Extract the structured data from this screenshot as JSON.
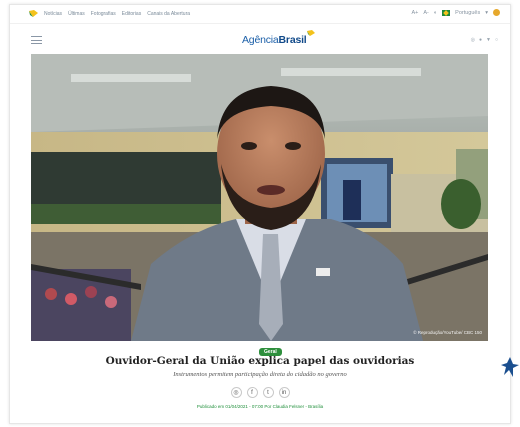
{
  "topbar": {
    "links": [
      "Notícias",
      "Últimas",
      "Fotografias",
      "Editorias",
      "Canais da Abertura"
    ],
    "language": "Português"
  },
  "header": {
    "logo_prefix": "Agência",
    "logo_bold": "Brasil"
  },
  "hero": {
    "credit": "© Reprodução/YouTube/ CBC 150"
  },
  "article": {
    "category": "Geral",
    "title": "Ouvidor-Geral da União explica papel das ouvidorias",
    "subtitle": "Instrumentos permitem participação direta do cidadão no governo",
    "published": "Publicado em 01/04/2021 - 07:00 Por Claudia Felsner - Brasília"
  },
  "share": {
    "icons": [
      "whatsapp-icon",
      "facebook-icon",
      "twitter-icon",
      "linkedin-icon"
    ],
    "glyphs": [
      "◎",
      "f",
      "t",
      "in"
    ]
  },
  "colors": {
    "brand_blue": "#1b5fa8",
    "accent_green": "#2e8f3d",
    "accent_yellow": "#f3c21b"
  }
}
